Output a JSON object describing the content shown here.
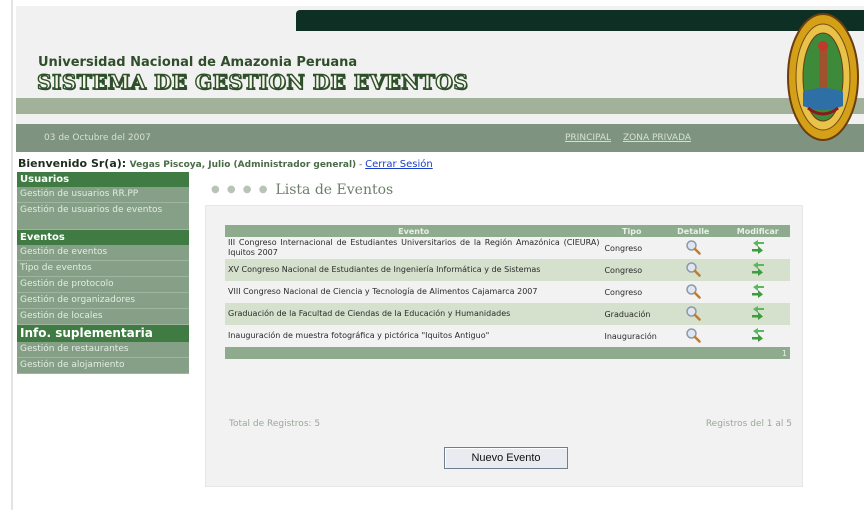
{
  "header": {
    "university": "Universidad Nacional de Amazonia Peruana",
    "system_title": "SISTEMA DE GESTION DE EVENTOS",
    "date": "03 de Octubre del 2007",
    "nav": {
      "principal": "PRINCIPAL",
      "zona_privada": "ZONA PRIVADA"
    }
  },
  "welcome": {
    "label": "Bienvenido Sr(a):",
    "user": "Vegas Piscoya, Julio (Administrador general)",
    "separator": " - ",
    "logout": "Cerrar Sesión"
  },
  "sidebar": {
    "sections": [
      {
        "title": "Usuarios",
        "items": [
          "Gestión de usuarios RR.PP",
          "Gestión de usuarios de eventos"
        ]
      },
      {
        "title": "Eventos",
        "items": [
          "Gestión de eventos",
          "Tipo de eventos",
          "Gestión de protocolo",
          "Gestión de organizadores",
          "Gestión de locales"
        ]
      },
      {
        "title": "Info. suplementaria",
        "items": [
          "Gestión de restaurantes",
          "Gestión de alojamiento"
        ]
      }
    ]
  },
  "main": {
    "title": "Lista de Eventos",
    "table": {
      "headers": {
        "evento": "Evento",
        "tipo": "Tipo",
        "detalle": "Detalle",
        "modificar": "Modificar"
      },
      "rows": [
        {
          "evento": "III Congreso Internacional de Estudiantes Universitarios de la Región Amazónica (CIEURA) Iquitos 2007",
          "tipo": "Congreso"
        },
        {
          "evento": "XV Congreso Nacional de Estudiantes de Ingeniería Informática y de Sistemas",
          "tipo": "Congreso"
        },
        {
          "evento": "VIII Congreso Nacional de Ciencia y Tecnología de Alimentos Cajamarca 2007",
          "tipo": "Congreso"
        },
        {
          "evento": "Graduación de la Facultad de Ciendas de la Educación y Humanidades",
          "tipo": "Graduación"
        },
        {
          "evento": "Inauguración de muestra fotográfica y pictórica \"Iquitos Antiguo\"",
          "tipo": "Inauguración"
        }
      ],
      "page_number": "1"
    },
    "total": "Total de Registros: 5",
    "range": "Registros del 1 al 5",
    "new_button": "Nuevo Evento"
  },
  "colors": {
    "dark_bar": "#0e2f24",
    "sidebar_header": "#3f7b42",
    "sidebar_item": "#86a087",
    "table_header": "#8eab8e",
    "row_alt": "#d5e0cd",
    "link": "#1a3fc4"
  },
  "icons": {
    "detail": "magnifier-icon",
    "modify": "green-arrows-icon",
    "seal": "university-seal"
  }
}
